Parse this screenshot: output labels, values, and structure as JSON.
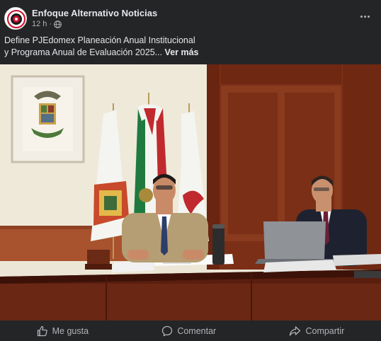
{
  "post": {
    "page_name": "Enfoque Alternativo Noticias",
    "time": "12 h",
    "separator": "·",
    "audience_icon": "globe-icon",
    "text_line1": "Define PJEdomex Planeación Anual Institucional",
    "text_line2": "y  Programa Anual de Evaluación 2025...",
    "see_more": "Ver más",
    "more_icon": "more-options-icon"
  },
  "actions": [
    {
      "label": "Me gusta",
      "icon": "thumbs-up-icon"
    },
    {
      "label": "Comentar",
      "icon": "comment-icon"
    },
    {
      "label": "Compartir",
      "icon": "share-icon"
    }
  ],
  "colors": {
    "background": "#242526",
    "text": "#e4e6eb",
    "secondary_text": "#b0b3b8"
  }
}
